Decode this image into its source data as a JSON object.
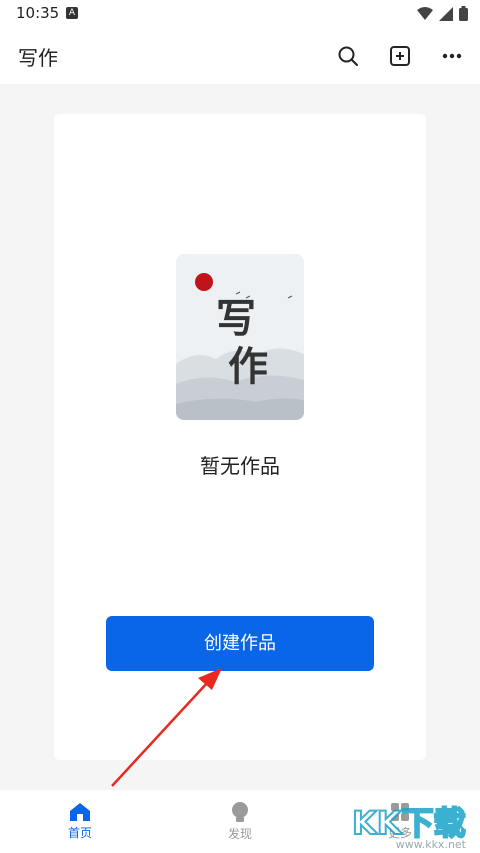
{
  "status_bar": {
    "time": "10:35",
    "notification_badge": "A"
  },
  "header": {
    "title": "写作",
    "search_icon": "search-icon",
    "add_icon": "add-square-icon",
    "more_icon": "more-dots-icon"
  },
  "main": {
    "illustration_text": "写作",
    "empty_state_text": "暂无作品",
    "create_button_label": "创建作品"
  },
  "bottom_nav": {
    "items": [
      {
        "label": "首页",
        "icon": "home-icon",
        "active": true
      },
      {
        "label": "发现",
        "icon": "lightbulb-icon",
        "active": false
      },
      {
        "label": "更多",
        "icon": "grid-icon",
        "active": false
      }
    ]
  },
  "watermark": {
    "logo_text": "KK下载",
    "url": "www.kkx.net"
  },
  "colors": {
    "accent": "#0a66e8",
    "annotation_arrow": "#e8291f"
  }
}
